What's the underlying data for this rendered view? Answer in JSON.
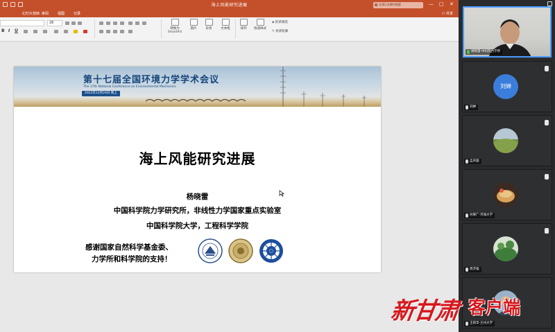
{
  "window": {
    "title": "海上风能研究进展",
    "search_placeholder": "在演示文稿中搜索",
    "share_label": "共享",
    "controls": [
      "—",
      "□",
      "✕"
    ]
  },
  "ribbon_tabs": [
    "幻灯片放映",
    "审阅",
    "视图",
    "记录"
  ],
  "ribbon": {
    "font_name": "",
    "font_size": "28",
    "buttons": {
      "smartart": "转换为 SmartArt",
      "picture": "图片",
      "shape": "形状",
      "textbox": "文本框",
      "arrange": "排列",
      "quick_styles": "快速样式",
      "shape_fill": "形状填充",
      "shape_outline": "形状轮廓"
    }
  },
  "slide": {
    "banner_title": "第十七届全国环境力学学术会议",
    "banner_subtitle": "The 17th National Conference on Environmental Mechanics",
    "banner_date": "2022年12月24日  晚上",
    "title": "海上风能研究进展",
    "author": "杨晓雷",
    "affiliation_1": "中国科学院力学研究所，非线性力学国家重点实验室",
    "affiliation_2": "中国科学院大学，工程科学学院",
    "thanks_1": "感谢国家自然科学基金委、",
    "thanks_2": "力学所和科学院的支持！",
    "logos": [
      "nsfc-logo",
      "imech-logo",
      "cas-logo"
    ]
  },
  "participants": [
    {
      "name": "杨晓雷-中科院力学所",
      "type": "video"
    },
    {
      "name": "刘婵",
      "type": "avatar",
      "avatar_text": "刘婵",
      "avatar_color": "#3b7ddb"
    },
    {
      "name": "孟庆国",
      "type": "photo"
    },
    {
      "name": "孙厚广-河海大学",
      "type": "photo"
    },
    {
      "name": "周济福",
      "type": "photo"
    },
    {
      "name": "王莉华-兰州大学",
      "type": "photo"
    }
  ],
  "watermark": {
    "brand": "新甘肃",
    "suffix": "客户端",
    "color": "#d6191e"
  }
}
